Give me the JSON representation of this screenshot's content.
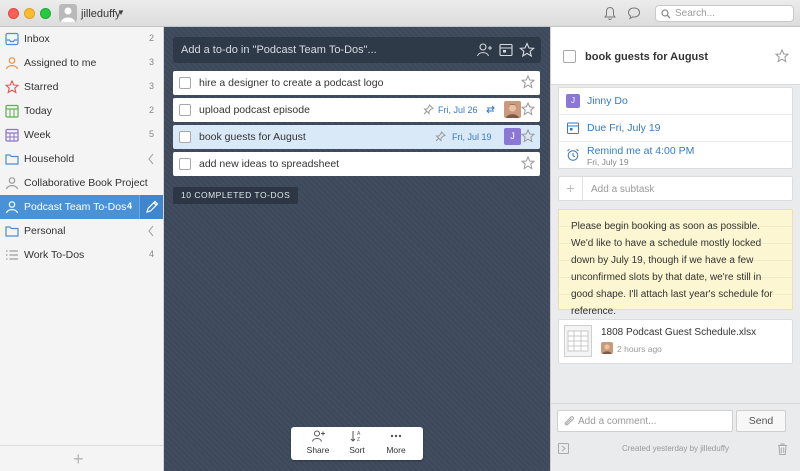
{
  "user": {
    "name": "jilleduffy"
  },
  "search": {
    "placeholder": "Search..."
  },
  "sidebar": {
    "items": [
      {
        "label": "Inbox",
        "count": "2",
        "icon": "inbox-icon"
      },
      {
        "label": "Assigned to me",
        "count": "3",
        "icon": "person-icon"
      },
      {
        "label": "Starred",
        "count": "3",
        "icon": "star-icon"
      },
      {
        "label": "Today",
        "count": "2",
        "icon": "calendar-today-icon"
      },
      {
        "label": "Week",
        "count": "5",
        "icon": "calendar-week-icon"
      },
      {
        "label": "Household",
        "count": "",
        "icon": "folder-icon"
      },
      {
        "label": "Collaborative Book Project",
        "count": "",
        "icon": "people-icon"
      },
      {
        "label": "Podcast Team To-Dos",
        "count": "4",
        "icon": "people-icon"
      },
      {
        "label": "Personal",
        "count": "",
        "icon": "folder-icon"
      },
      {
        "label": "Work To-Dos",
        "count": "4",
        "icon": "list-icon"
      }
    ]
  },
  "list": {
    "add_placeholder": "Add a to-do in \"Podcast Team To-Dos\"...",
    "tasks": [
      {
        "title": "hire a designer to create a podcast logo",
        "due": ""
      },
      {
        "title": "upload podcast episode",
        "due": "Fri, Jul 26"
      },
      {
        "title": "book guests for August",
        "due": "Fri, Jul 19",
        "assignee": "J"
      },
      {
        "title": "add new ideas to spreadsheet",
        "due": ""
      }
    ],
    "completed_label": "10 COMPLETED TO-DOS",
    "tools": {
      "share": "Share",
      "sort": "Sort",
      "more": "More"
    }
  },
  "detail": {
    "title": "book guests for August",
    "assignee": "Jinny Do",
    "assignee_initial": "J",
    "due": "Due Fri, July 19",
    "reminder": "Remind me at 4:00 PM",
    "reminder_sub": "Fri, July 19",
    "subtask_placeholder": "Add a subtask",
    "note": "Please begin booking as soon as possible. We'd like to have a schedule mostly locked down by July 19, though if we have a few unconfirmed slots by that date, we're still in good shape. I'll attach last year's schedule for reference.",
    "file_name": "1808 Podcast Guest Schedule.xlsx",
    "file_time": "2 hours ago",
    "comment_placeholder": "Add a comment...",
    "send_label": "Send",
    "created": "Created yesterday by jilleduffy"
  },
  "colors": {
    "accent": "#4a92d8",
    "due": "#3579c8",
    "assignee": "#8b77d6",
    "list_bg": "#3d4a5c",
    "note_bg": "#fcf7d2"
  }
}
